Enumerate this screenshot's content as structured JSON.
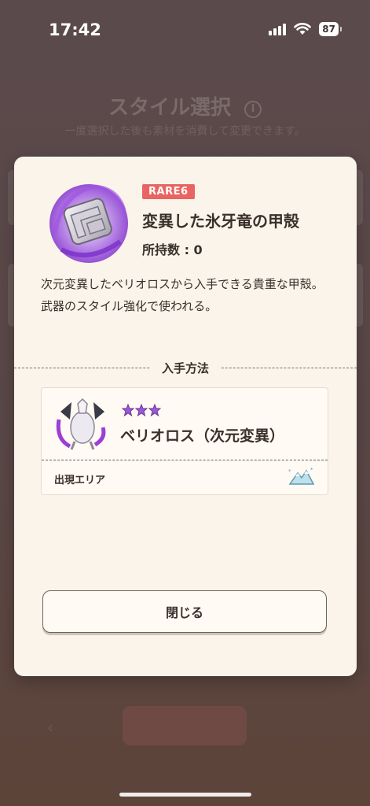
{
  "status_bar": {
    "time": "17:42",
    "battery": "87"
  },
  "background": {
    "title": "スタイル選択",
    "info_icon": "info-icon",
    "subtitle": "一度選択した後も素材を消費して変更できます。"
  },
  "modal": {
    "rarity": "RARE6",
    "item_name": "変異した氷牙竜の甲殻",
    "owned_count": "所持数 : 0",
    "description": "次元変異したベリオロスから入手できる貴重な甲殻。武器のスタイル強化で使われる。",
    "section_title": "入手方法",
    "source": {
      "stars": 3,
      "monster_name": "ベリオロス（次元変異）",
      "area_label": "出現エリア",
      "area_icon": "snow-mountain-icon"
    },
    "close_label": "閉じる"
  },
  "colors": {
    "rarity": "#ea6461",
    "star": "#9a5ad6",
    "modal_bg": "#fbf4ea"
  }
}
